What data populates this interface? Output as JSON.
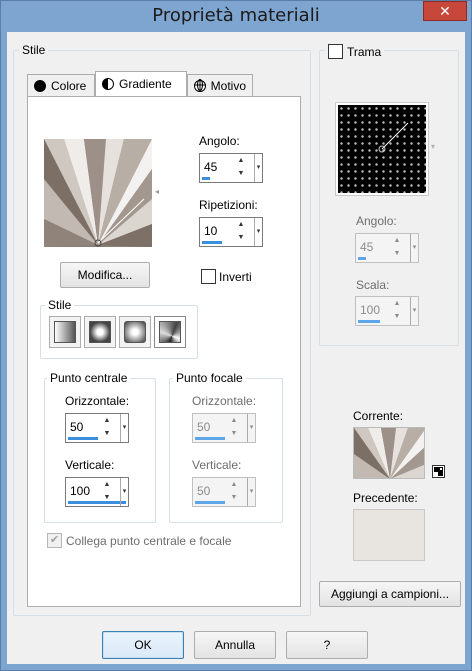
{
  "window": {
    "title": "Proprietà materiali",
    "close_label": "✕"
  },
  "left_group": {
    "label": "Stile"
  },
  "tabs": [
    {
      "label": "Colore",
      "icon": "filled-circle-icon"
    },
    {
      "label": "Gradiente",
      "icon": "half-circle-icon"
    },
    {
      "label": "Motivo",
      "icon": "globe-icon"
    }
  ],
  "gradient": {
    "angle_label": "Angolo:",
    "angle_value": "45",
    "repeats_label": "Ripetizioni:",
    "repeats_value": "10",
    "edit_button": "Modifica...",
    "invert_label": "Inverti",
    "style_group_label": "Stile",
    "center_group_label": "Punto centrale",
    "focal_group_label": "Punto focale",
    "horizontal_label": "Orizzontale:",
    "vertical_label": "Verticale:",
    "center_horizontal": "50",
    "center_vertical": "100",
    "focal_horizontal": "50",
    "focal_vertical": "50",
    "link_label": "Collega punto centrale e focale",
    "link_check": "✔"
  },
  "texture": {
    "checkbox_label": "Trama",
    "angle_label": "Angolo:",
    "angle_value": "45",
    "scale_label": "Scala:",
    "scale_value": "100"
  },
  "swatches": {
    "current_label": "Corrente:",
    "previous_label": "Precedente:",
    "add_button": "Aggiungi a campioni..."
  },
  "footer": {
    "ok": "OK",
    "cancel": "Annulla",
    "help": "?"
  },
  "colors": {
    "accent": "#3a8ede",
    "gradient_dark": "#6e6259",
    "gradient_light": "#f2f0ee",
    "previous_swatch": "#e8e4e0"
  }
}
